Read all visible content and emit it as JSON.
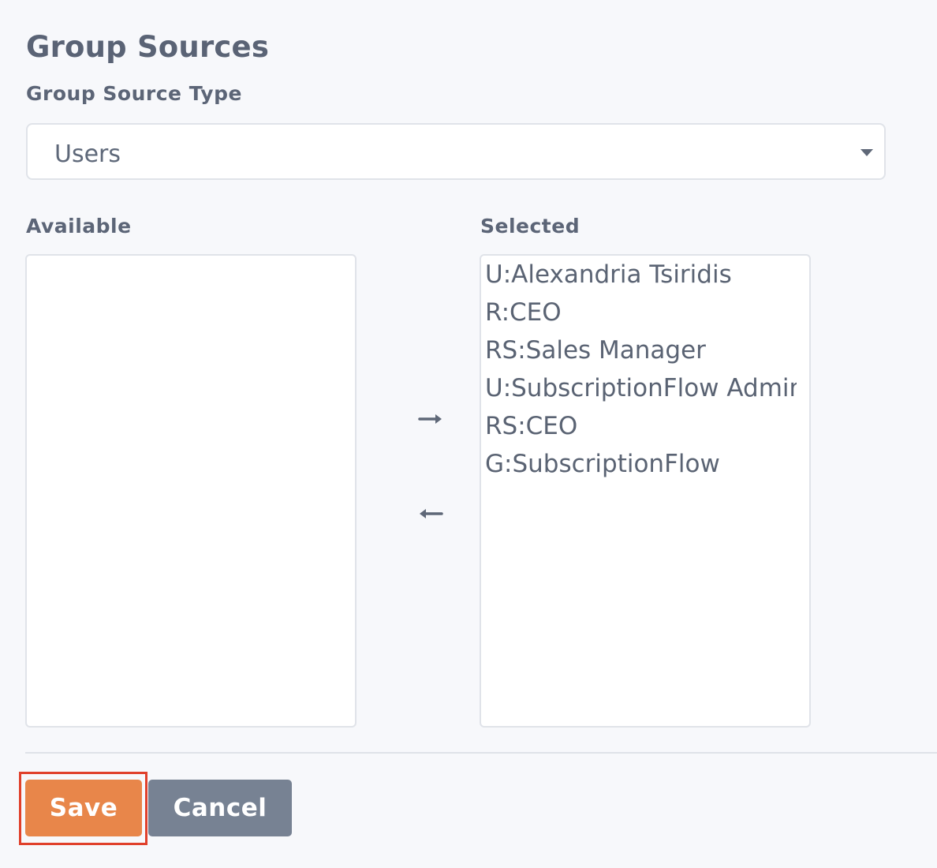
{
  "header": {
    "title": "Group Sources",
    "source_type_label": "Group Source Type"
  },
  "source_type_select": {
    "value": "Users"
  },
  "available": {
    "label": "Available",
    "items": []
  },
  "selected": {
    "label": "Selected",
    "items": [
      "U:Alexandria Tsiridis",
      "R:CEO",
      "RS:Sales Manager",
      "U:SubscriptionFlow Admin",
      "RS:CEO",
      "G:SubscriptionFlow"
    ]
  },
  "buttons": {
    "save": "Save",
    "cancel": "Cancel"
  },
  "colors": {
    "save": "#e8864a",
    "cancel": "#778293",
    "highlight": "#e0402b"
  }
}
